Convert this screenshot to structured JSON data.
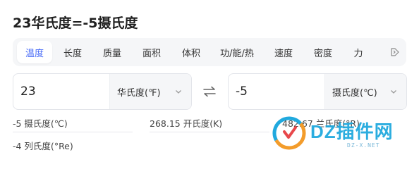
{
  "title": "23华氏度=-5摄氏度",
  "tabs": [
    {
      "label": "温度",
      "active": true
    },
    {
      "label": "长度",
      "active": false
    },
    {
      "label": "质量",
      "active": false
    },
    {
      "label": "面积",
      "active": false
    },
    {
      "label": "体积",
      "active": false
    },
    {
      "label": "功/能/热",
      "active": false
    },
    {
      "label": "速度",
      "active": false
    },
    {
      "label": "密度",
      "active": false
    },
    {
      "label": "力",
      "active": false
    }
  ],
  "converter": {
    "left": {
      "value": "23",
      "unit": "华氏度(℉)"
    },
    "right": {
      "value": "-5",
      "unit": "摄氏度(℃)"
    }
  },
  "results": [
    "-5 摄氏度(℃)",
    "268.15 开氏度(K)",
    "482.67 兰氏度(°R)",
    "-4 列氏度(°Re)"
  ],
  "watermark": {
    "main": "DZ插件网",
    "sub": "DZ-X.NET"
  },
  "colors": {
    "accent": "#4a6cf7",
    "tab_bg": "#f5f6f8",
    "border": "#e3e5ea",
    "watermark": "#20a9de"
  }
}
